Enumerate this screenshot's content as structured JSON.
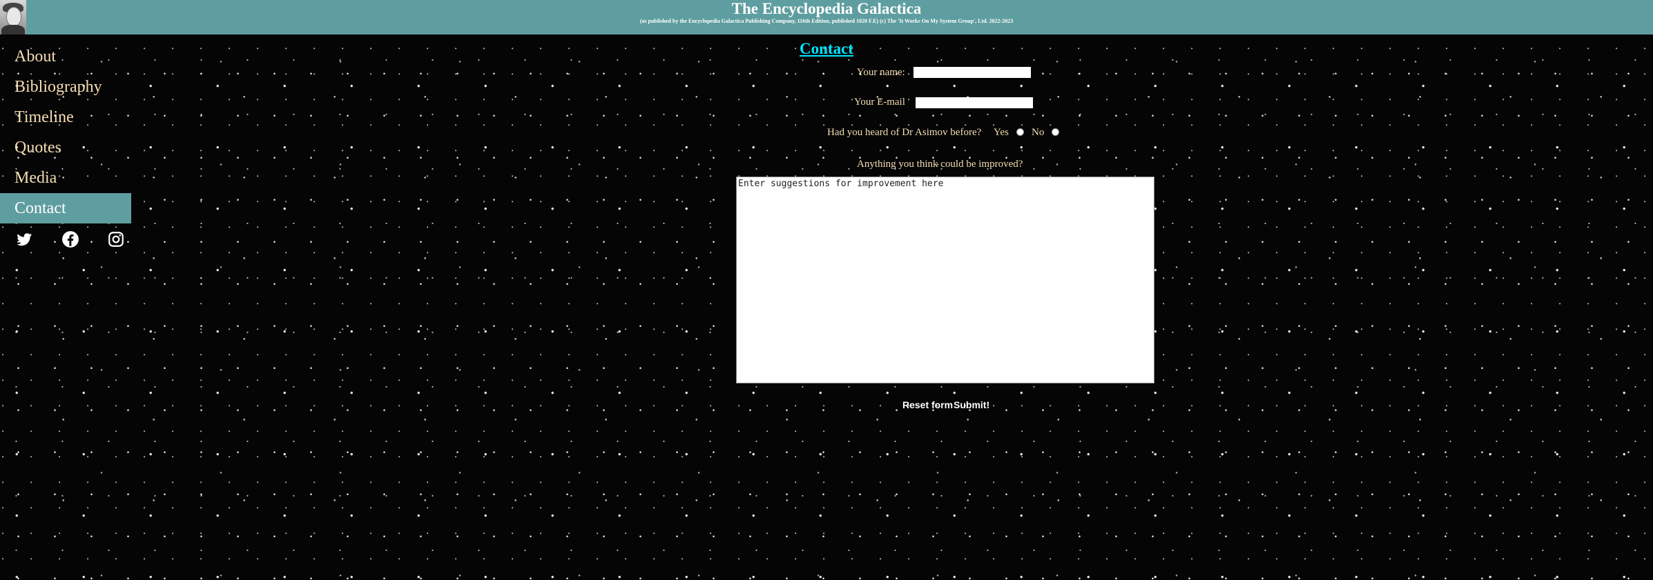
{
  "header": {
    "title": "The Encyclopedia Galactica",
    "subtitle": "(as published by the Encyclopedia Galactica Publishing Company, 116th Edition, published 1020 F.E) (c) The 'It Works On My System Group', Ltd. 2022-2023",
    "avatar_icon": "portrait-avatar"
  },
  "nav": {
    "items": [
      {
        "label": "About"
      },
      {
        "label": "Bibliography"
      },
      {
        "label": "Timeline"
      },
      {
        "label": "Quotes"
      },
      {
        "label": "Media"
      },
      {
        "label": "Contact"
      }
    ],
    "active": "Contact",
    "socials": [
      "twitter-icon",
      "facebook-icon",
      "instagram-icon"
    ]
  },
  "form": {
    "title": "Contact",
    "name_label": "Your name:",
    "name_value": "",
    "email_label": "Your E-mail",
    "email_value": "",
    "question_label": "Had you heard of Dr Asimov before?",
    "yes_label": "Yes",
    "no_label": "No",
    "improve_label": "Anything you think could be improved?",
    "suggestions_placeholder": "Enter suggestions for improvement here",
    "reset_label": "Reset form",
    "submit_label": "Submit!"
  },
  "colors": {
    "header_bg": "#5f9ea0",
    "nav_text": "#f5deb3",
    "title_link": "#00e5ff",
    "background": "#050505"
  }
}
